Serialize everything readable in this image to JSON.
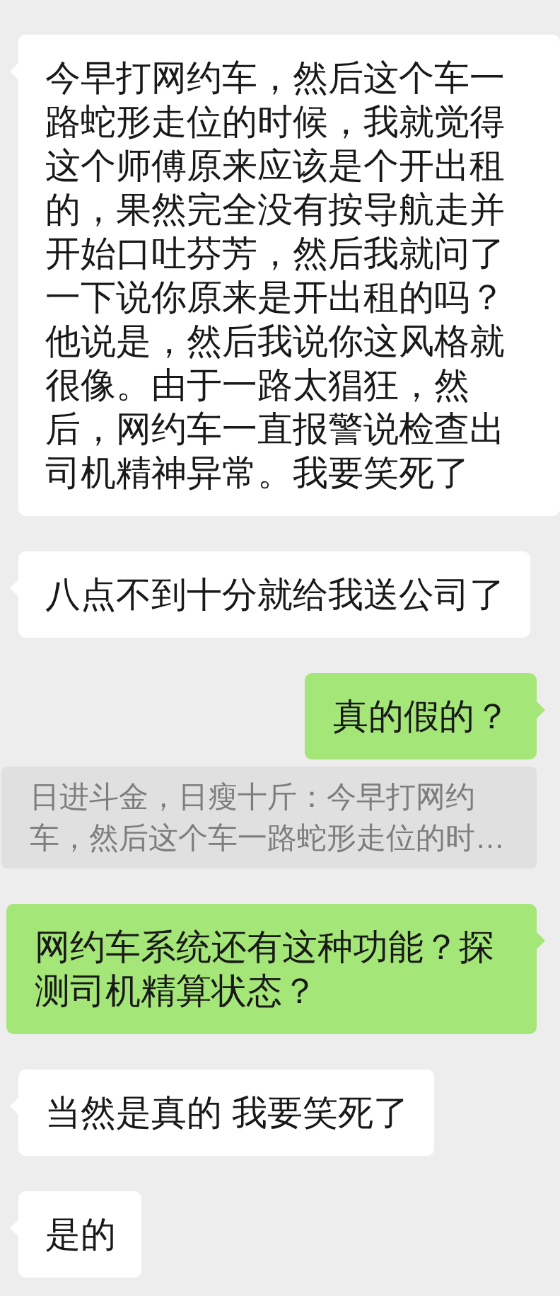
{
  "messages": [
    {
      "kind": "received",
      "text": "今早打网约车，然后这个车一路蛇形走位的时候，我就觉得这个师傅原来应该是个开出租的，果然完全没有按导航走并开始口吐芬芳，然后我就问了一下说你原来是开出租的吗？他说是，然后我说你这风格就很像。由于一路太猖狂，然后，网约车一直报警说检查出司机精神异常。我要笑死了"
    },
    {
      "kind": "received",
      "text": "八点不到十分就给我送公司了"
    },
    {
      "kind": "sent",
      "text": "真的假的？"
    },
    {
      "kind": "quote",
      "text": "日进斗金，日瘦十斤：今早打网约车，然后这个车一路蛇形走位的时…"
    },
    {
      "kind": "sent",
      "text": "网约车系统还有这种功能？探测司机精算状态？"
    },
    {
      "kind": "received",
      "text": "当然是真的 我要笑死了"
    },
    {
      "kind": "received",
      "text": "是的"
    }
  ]
}
